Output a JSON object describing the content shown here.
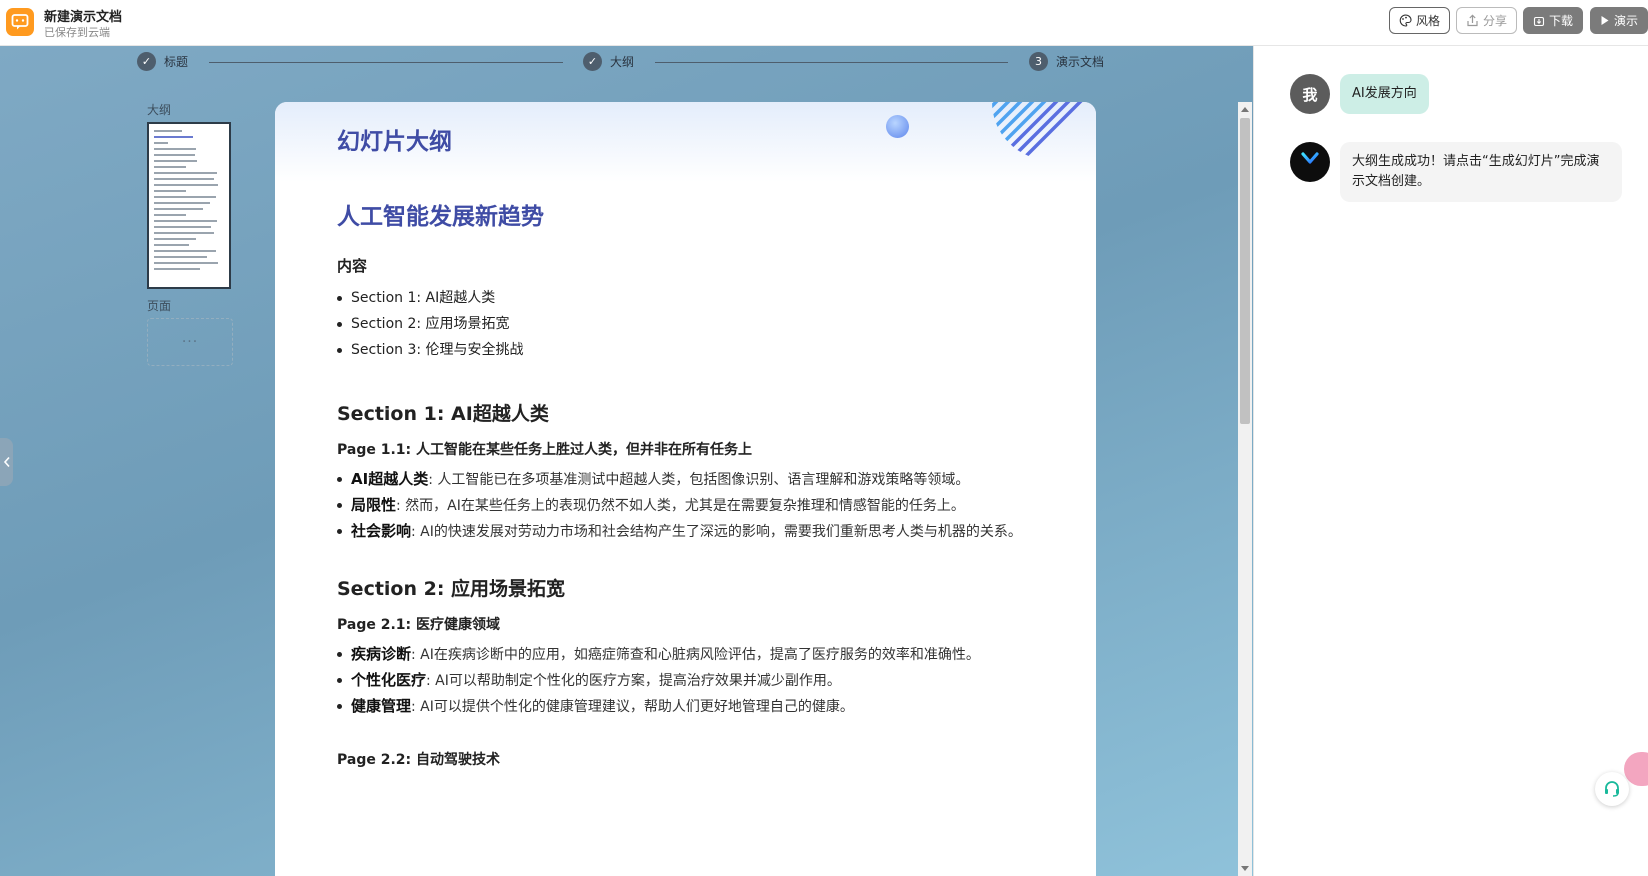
{
  "header": {
    "doc_title": "新建演示文档",
    "save_status": "已保存到云端",
    "buttons": {
      "style": "风格",
      "share": "分享",
      "download": "下载",
      "present": "演示"
    }
  },
  "progress": {
    "steps": [
      {
        "num": "",
        "label": "标题",
        "done": true
      },
      {
        "num": "",
        "label": "大纲",
        "done": true
      },
      {
        "num": "3",
        "label": "演示文档",
        "done": false
      }
    ]
  },
  "left_panel": {
    "outline_label": "大纲",
    "pages_label": "页面",
    "pages_placeholder": "···"
  },
  "slide": {
    "header_title": "幻灯片大纲",
    "main_title": "人工智能发展新趋势",
    "toc_heading": "内容",
    "toc": [
      "Section 1: AI超越人类",
      "Section 2: 应用场景拓宽",
      "Section 3: 伦理与安全挑战"
    ],
    "sections": [
      {
        "title": "Section 1: AI超越人类",
        "pages": [
          {
            "title": "Page 1.1: 人工智能在某些任务上胜过人类，但并非在所有任务上",
            "bullets": [
              {
                "term": "AI超越人类",
                "text": ": 人工智能已在多项基准测试中超越人类，包括图像识别、语言理解和游戏策略等领域。"
              },
              {
                "term": "局限性",
                "text": ": 然而，AI在某些任务上的表现仍然不如人类，尤其是在需要复杂推理和情感智能的任务上。"
              },
              {
                "term": "社会影响",
                "text": ": AI的快速发展对劳动力市场和社会结构产生了深远的影响，需要我们重新思考人类与机器的关系。"
              }
            ]
          }
        ]
      },
      {
        "title": "Section 2: 应用场景拓宽",
        "pages": [
          {
            "title": "Page 2.1: 医疗健康领域",
            "bullets": [
              {
                "term": "疾病诊断",
                "text": ": AI在疾病诊断中的应用，如癌症筛查和心脏病风险评估，提高了医疗服务的效率和准确性。"
              },
              {
                "term": "个性化医疗",
                "text": ": AI可以帮助制定个性化的医疗方案，提高治疗效果并减少副作用。"
              },
              {
                "term": "健康管理",
                "text": ": AI可以提供个性化的健康管理建议，帮助人们更好地管理自己的健康。"
              }
            ]
          },
          {
            "title": "Page 2.2: 自动驾驶技术",
            "bullets": []
          }
        ]
      }
    ]
  },
  "chat": {
    "user_avatar": "我",
    "user_message": "AI发展方向",
    "bot_message": "大纲生成成功！请点击“生成幻灯片”完成演示文档创建。"
  },
  "colors": {
    "accent_title": "#3f4ca5",
    "logo": "#ff9a1f",
    "user_bubble": "#cdeee6",
    "main_bg": "#7fa9c4"
  }
}
